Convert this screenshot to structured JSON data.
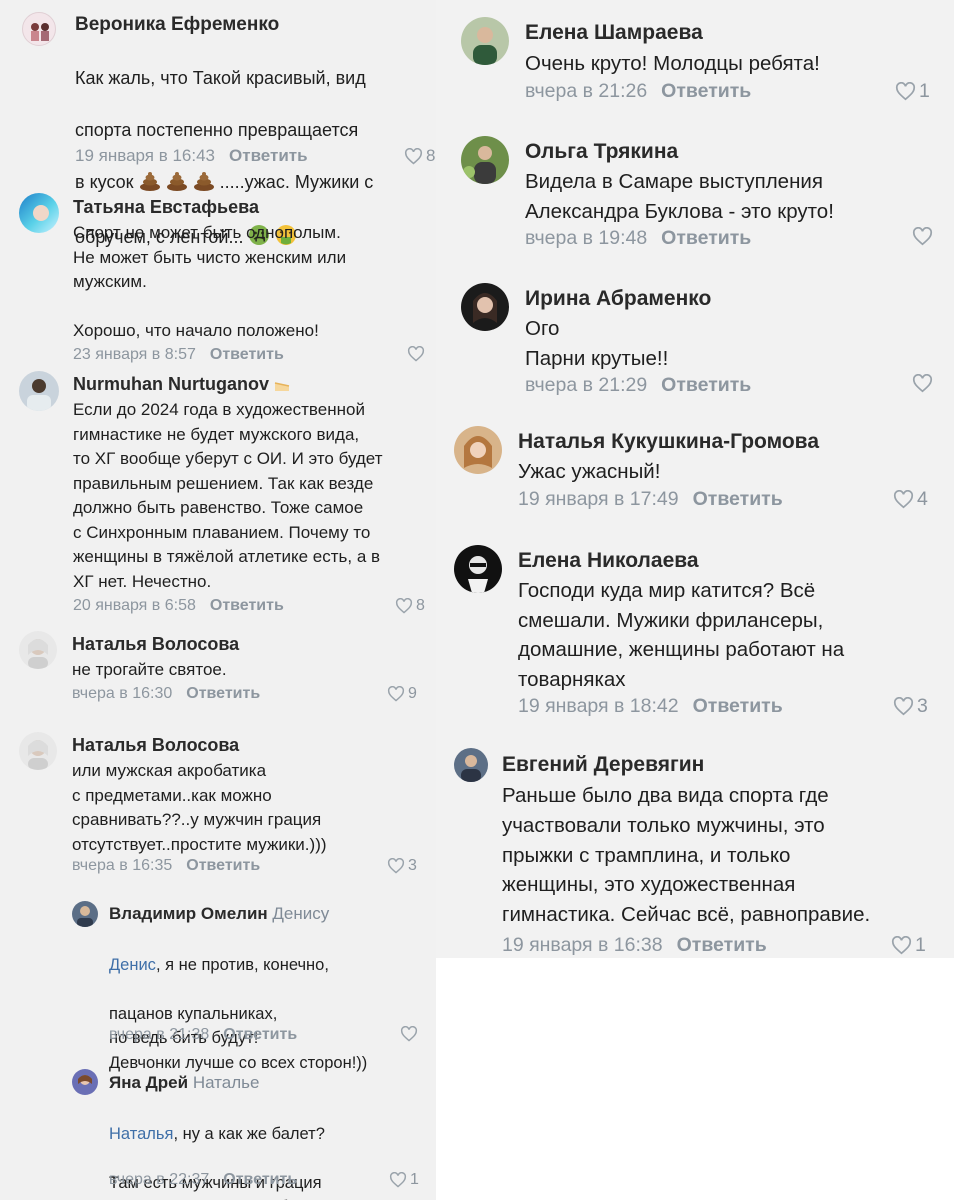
{
  "left": {
    "comments": [
      {
        "author": "Вероника Ефременко",
        "text_lines": [
          "Как жаль, что Такой красивый,  вид",
          "спорта постепенно превращается",
          "в кусок {E}{E}{E} .....ужас. Мужики с",
          "обручем, с лентой... {S}{V}"
        ],
        "line1": "Как жаль, что Такой красивый,  вид",
        "line2": "спорта постепенно превращается",
        "line3_a": "в кусок ",
        "line3_b": " .....ужас. Мужики с",
        "line4_a": "обручем, с лентой... ",
        "date": "19 января в 16:43",
        "reply": "Ответить",
        "likes": "8",
        "emoji": [
          "poop-emoji",
          "poop-emoji",
          "poop-emoji",
          "nauseated-face-emoji",
          "vomiting-face-emoji"
        ]
      },
      {
        "author": "Татьяна Евстафьева",
        "text": "Спорт не может быть однополым.\nНе может быть чисто женским или\nмужским.\n\nХорошо, что начало положено!",
        "date": "23 января в 8:57",
        "reply": "Ответить",
        "likes": ""
      },
      {
        "author": "Nurmuhan Nurtuganov",
        "badge_icon": "cake-emoji",
        "text": "Если до 2024 года в художественной\nгимнастике не будет мужского вида,\nто ХГ вообще уберут с ОИ. И это будет\nправильным решением. Так как везде\nдолжно быть равенство. Тоже самое\nс Синхронным плаванием. Почему то\nженщины в тяжёлой атлетике есть, а в\nХГ нет. Нечестно.",
        "date": "20 января в 6:58",
        "reply": "Ответить",
        "likes": "8"
      },
      {
        "author": "Наталья Волосова",
        "text": "не трогайте святое.",
        "date": "вчера в 16:30",
        "reply": "Ответить",
        "likes": "9"
      },
      {
        "author": "Наталья Волосова",
        "text": "или мужская акробатика\nс предметами..как можно\nсравнивать??..у мужчин грация\nотсутствует..простите мужики.)))",
        "date": "вчера в 16:35",
        "reply": "Ответить",
        "likes": "3"
      },
      {
        "author": "Владимир Омелин",
        "reply_to": "Денису",
        "mention": "Денис",
        "text_after_mention": ", я не против, конечно,",
        "text": "пацанов купальниках,\nно ведь бить будут!\nДевчонки лучше со всех сторон!))",
        "date": "вчера в 21:38",
        "reply": "Ответить",
        "likes": ""
      },
      {
        "author": "Яна Дрей",
        "reply_to": "Наталье",
        "mention": "Наталья",
        "text_after_mention": ", ну а как же балет?",
        "text": "Там есть мужчины и грация\nприсутствует. Почему бы и нет",
        "date": "вчера в 22:37",
        "reply": "Ответить",
        "likes": "1"
      }
    ]
  },
  "right": {
    "comments": [
      {
        "author": "Елена Шамраева",
        "text": "Очень круто! Молодцы ребята!",
        "date": "вчера в 21:26",
        "reply": "Ответить",
        "likes": "1"
      },
      {
        "author": "Ольга Трякина",
        "text": "Видела в Самаре выступления\nАлександра Буклова - это круто!",
        "date": "вчера в 19:48",
        "reply": "Ответить",
        "likes": ""
      },
      {
        "author": "Ирина Абраменко",
        "text": "Ого\nПарни крутые!!",
        "date": "вчера в 21:29",
        "reply": "Ответить",
        "likes": ""
      },
      {
        "author": "Наталья Кукушкина-Громова",
        "text": "Ужас ужасный!",
        "date": "19 января в 17:49",
        "reply": "Ответить",
        "likes": "4"
      },
      {
        "author": "Елена Николаева",
        "text": "Господи куда мир катится?  Всё\nсмешали. Мужики фрилансеры,\nдомашние, женщины работают на\nтоварняках",
        "date": "19 января в 18:42",
        "reply": "Ответить",
        "likes": "3"
      },
      {
        "author": "Евгений Деревягин",
        "text": "Раньше было два вида спорта где\nучаствовали только мужчины, это\nпрыжки с трамплина, и только\nженщины, это художественная\nгимнастика. Сейчас всё, равноправие.",
        "date": "19 января в 16:38",
        "reply": "Ответить",
        "likes": "1"
      }
    ]
  },
  "icons": {
    "like": "heart-outline-icon"
  },
  "colors": {
    "background": "#f1f1f1",
    "meta": "#8d969f",
    "mention": "#3f6fa8",
    "text": "#1f1f1f"
  }
}
